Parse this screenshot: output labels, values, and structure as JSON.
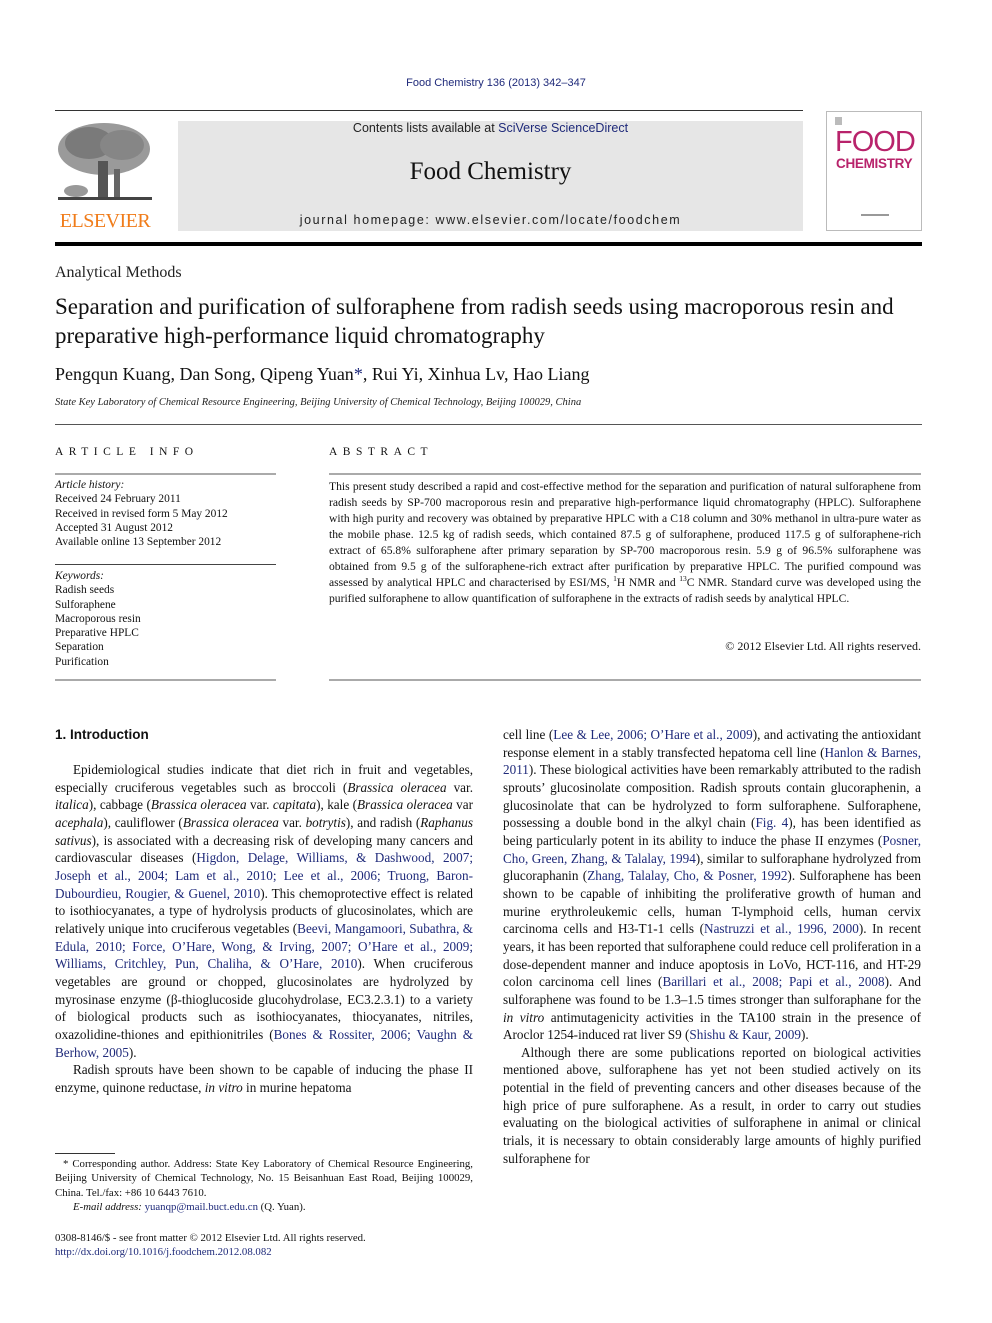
{
  "header": {
    "citation": "Food Chemistry 136 (2013) 342–347",
    "contents_prefix": "Contents lists available at ",
    "contents_link": "SciVerse ScienceDirect",
    "journal_title": "Food Chemistry",
    "homepage": "journal homepage: www.elsevier.com/locate/foodchem",
    "publisher_logo_text": "ELSEVIER",
    "cover_word_1": "FOOD",
    "cover_word_2": "CHEMISTRY"
  },
  "article": {
    "section": "Analytical Methods",
    "title": "Separation and purification of sulforaphene from radish seeds using macroporous resin and preparative high-performance liquid chromatography",
    "authors_before": "Pengqun Kuang, Dan Song, Qipeng Yuan",
    "author_star": "*",
    "authors_after": ", Rui Yi, Xinhua Lv, Hao Liang",
    "affiliation": "State Key Laboratory of Chemical Resource Engineering, Beijing University of Chemical Technology, Beijing 100029, China"
  },
  "article_info": {
    "heading": "ARTICLE INFO",
    "history_label": "Article history:",
    "history": [
      "Received 24 February 2011",
      "Received in revised form 5 May 2012",
      "Accepted 31 August 2012",
      "Available online 13 September 2012"
    ],
    "keywords_label": "Keywords:",
    "keywords": [
      "Radish seeds",
      "Sulforaphene",
      "Macroporous resin",
      "Preparative HPLC",
      "Separation",
      "Purification"
    ]
  },
  "abstract": {
    "heading": "ABSTRACT",
    "text_1": "This present study described a rapid and cost-effective method for the separation and purification of natural sulforaphene from radish seeds by SP-700 macroporous resin and preparative high-performance liquid chromatography (HPLC). Sulforaphene with high purity and recovery was obtained by preparative HPLC with a C18 column and 30% methanol in ultra-pure water as the mobile phase. 12.5 kg of radish seeds, which contained 87.5 g of sulforaphene, produced 117.5 g of sulforaphene-rich extract of 65.8% sulforaphene after primary separation by SP-700 macroporous resin. 5.9 g of 96.5% sulforaphene was obtained from 9.5 g of the sulforaphene-rich extract after purification by preparative HPLC. The purified compound was assessed by analytical HPLC and characterised by ESI/MS, ",
    "sup_1": "1",
    "text_2": "H NMR and ",
    "sup_2": "13",
    "text_3": "C NMR. Standard curve was developed using the purified sulforaphene to allow quantification of sulforaphene in the extracts of radish seeds by analytical HPLC.",
    "copyright": "© 2012 Elsevier Ltd. All rights reserved."
  },
  "introduction": {
    "heading": "1. Introduction",
    "p1": [
      {
        "t": "Epidemiological studies indicate that diet rich in fruit and vegetables, especially cruciferous vegetables such as broccoli ("
      },
      {
        "i": "Brassica oleracea"
      },
      {
        "t": " var. "
      },
      {
        "i": "italica"
      },
      {
        "t": "), cabbage ("
      },
      {
        "i": "Brassica oleracea"
      },
      {
        "t": " var. "
      },
      {
        "i": "capitata"
      },
      {
        "t": "), kale ("
      },
      {
        "i": "Brassica oleracea"
      },
      {
        "t": " var "
      },
      {
        "i": "acephala"
      },
      {
        "t": "), cauliflower ("
      },
      {
        "i": "Brassica oleracea"
      },
      {
        "t": " var. "
      },
      {
        "i": "botrytis"
      },
      {
        "t": "), and radish ("
      },
      {
        "i": "Raphanus sativus"
      },
      {
        "t": "), is associated with a decreasing risk of developing many cancers and cardiovascular diseases ("
      },
      {
        "l": "Higdon, Delage, Williams, & Dashwood, 2007; Joseph et al., 2004; Lam et al., 2010; Lee et al., 2006; Truong, Baron-Dubourdieu, Rougier, & Guenel, 2010"
      },
      {
        "t": "). This chemoprotective effect is related to isothiocyanates, a type of hydrolysis products of glucosinolates, which are relatively unique into cruciferous vegetables ("
      },
      {
        "l": "Beevi, Mangamoori, Subathra, & Edula, 2010; Force, O’Hare, Wong, & Irving, 2007; O’Hare et al., 2009; Williams, Critchley, Pun, Chaliha, & O’Hare, 2010"
      },
      {
        "t": "). When cruciferous vegetables are ground or chopped, glucosinolates are hydrolyzed by myrosinase enzyme (β-thioglucoside glucohydrolase, EC3.2.3.1) to a variety of biological products such as isothiocyanates, thiocyanates, nitriles, oxazolidine-thiones and epithionitriles ("
      },
      {
        "l": "Bones & Rossiter, 2006; Vaughn & Berhow, 2005"
      },
      {
        "t": ")."
      }
    ],
    "p2": [
      {
        "t": "Radish sprouts have been shown to be capable of inducing the phase II enzyme, quinone reductase, "
      },
      {
        "i": "in vitro"
      },
      {
        "t": " in murine hepatoma"
      }
    ],
    "p2_cont": [
      {
        "t": "cell line ("
      },
      {
        "l": "Lee & Lee, 2006; O’Hare et al., 2009"
      },
      {
        "t": "), and activating the antioxidant response element in a stably transfected hepatoma cell line ("
      },
      {
        "l": "Hanlon & Barnes, 2011"
      },
      {
        "t": "). These biological activities have been remarkably attributed to the radish sprouts’ glucosinolate composition. Radish sprouts contain glucoraphenin, a glucosinolate that can be hydrolyzed to form sulforaphene. Sulforaphene, possessing a double bond in the alkyl chain ("
      },
      {
        "l": "Fig. 4"
      },
      {
        "t": "), has been identified as being particularly potent in its ability to induce the phase II enzymes ("
      },
      {
        "l": "Posner, Cho, Green, Zhang, & Talalay, 1994"
      },
      {
        "t": "), similar to sulforaphane hydrolyzed from glucoraphanin ("
      },
      {
        "l": "Zhang, Talalay, Cho, & Posner, 1992"
      },
      {
        "t": "). Sulforaphene has been shown to be capable of inhibiting the proliferative growth of human and murine erythroleukemic cells, human T-lymphoid cells, human cervix carcinoma cells and H3-T1-1 cells ("
      },
      {
        "l": "Nastruzzi et al., 1996, 2000"
      },
      {
        "t": "). In recent years, it has been reported that sulforaphene could reduce cell proliferation in a dose-dependent manner and induce apoptosis in LoVo, HCT-116, and HT-29 colon carcinoma cell lines ("
      },
      {
        "l": "Barillari et al., 2008; Papi et al., 2008"
      },
      {
        "t": "). And sulforaphene was found to be 1.3–1.5 times stronger than sulforaphane for the "
      },
      {
        "i": "in vitro"
      },
      {
        "t": " antimutagenicity activities in the TA100 strain in the presence of Aroclor 1254-induced rat liver S9 ("
      },
      {
        "l": "Shishu & Kaur, 2009"
      },
      {
        "t": ")."
      }
    ],
    "p3": [
      {
        "t": "Although there are some publications reported on biological activities mentioned above, sulforaphene has yet not been studied actively on its potential in the field of preventing cancers and other diseases because of the high price of pure sulforaphene. As a result, in order to carry out studies evaluating on the biological activities of sulforaphene in animal or clinical trials, it is necessary to obtain considerably large amounts of highly purified sulforaphene for"
      }
    ]
  },
  "footnote": {
    "corresponding": "* Corresponding author. Address: State Key Laboratory of Chemical Resource Engineering, Beijing University of Chemical Technology, No. 15 Beisanhuan East Road, Beijing 100029, China. Tel./fax: +86 10 6443 7610.",
    "email_label": "E-mail address: ",
    "email": "yuanqp@mail.buct.edu.cn",
    "email_suffix": " (Q. Yuan)."
  },
  "front_matter": {
    "issn_line": "0308-8146/$ - see front matter © 2012 Elsevier Ltd. All rights reserved.",
    "doi": "http://dx.doi.org/10.1016/j.foodchem.2012.08.082"
  },
  "colors": {
    "link": "#1f2a7a",
    "elsevier_orange": "#f07c1a",
    "cover_magenta": "#b8236b",
    "banner_grey": "#e6e6e6"
  }
}
